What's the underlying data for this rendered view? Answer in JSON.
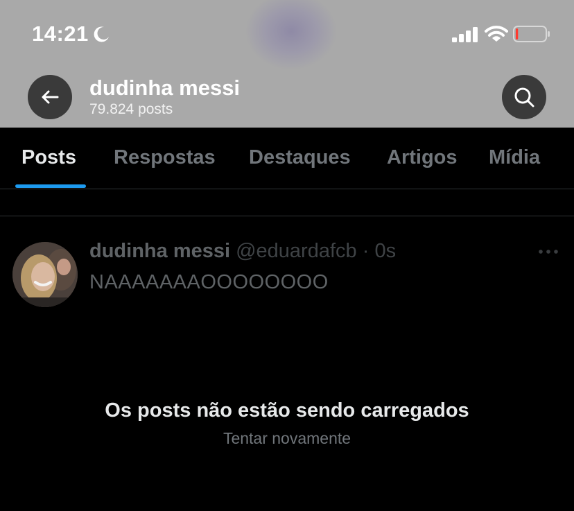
{
  "status_bar": {
    "time": "14:21",
    "icons": [
      "moon-icon",
      "cellular-signal-icon",
      "wifi-icon",
      "battery-low-icon"
    ],
    "battery_level_percent": 8,
    "battery_color": "#ff3b30"
  },
  "header": {
    "back_icon": "arrow-left-icon",
    "name": "dudinha messi",
    "posts_count": "79.824 posts",
    "search_icon": "search-icon"
  },
  "tabs": [
    {
      "label": "Posts",
      "active": true
    },
    {
      "label": "Respostas",
      "active": false
    },
    {
      "label": "Destaques",
      "active": false
    },
    {
      "label": "Artigos",
      "active": false
    },
    {
      "label": "Mídia",
      "active": false
    }
  ],
  "post": {
    "author": "dudinha messi",
    "handle": "@eduardafcb",
    "separator": " · ",
    "time": "0s",
    "text": "NAAAAAAAOOOOOOOO",
    "more_icon": "more-horizontal-icon"
  },
  "error": {
    "title": "Os posts não estão sendo carregados",
    "retry": "Tentar novamente"
  },
  "colors": {
    "background": "#000000",
    "header_bg": "#a9a9a9",
    "accent": "#1d9bf0",
    "muted_text": "#71767b"
  }
}
